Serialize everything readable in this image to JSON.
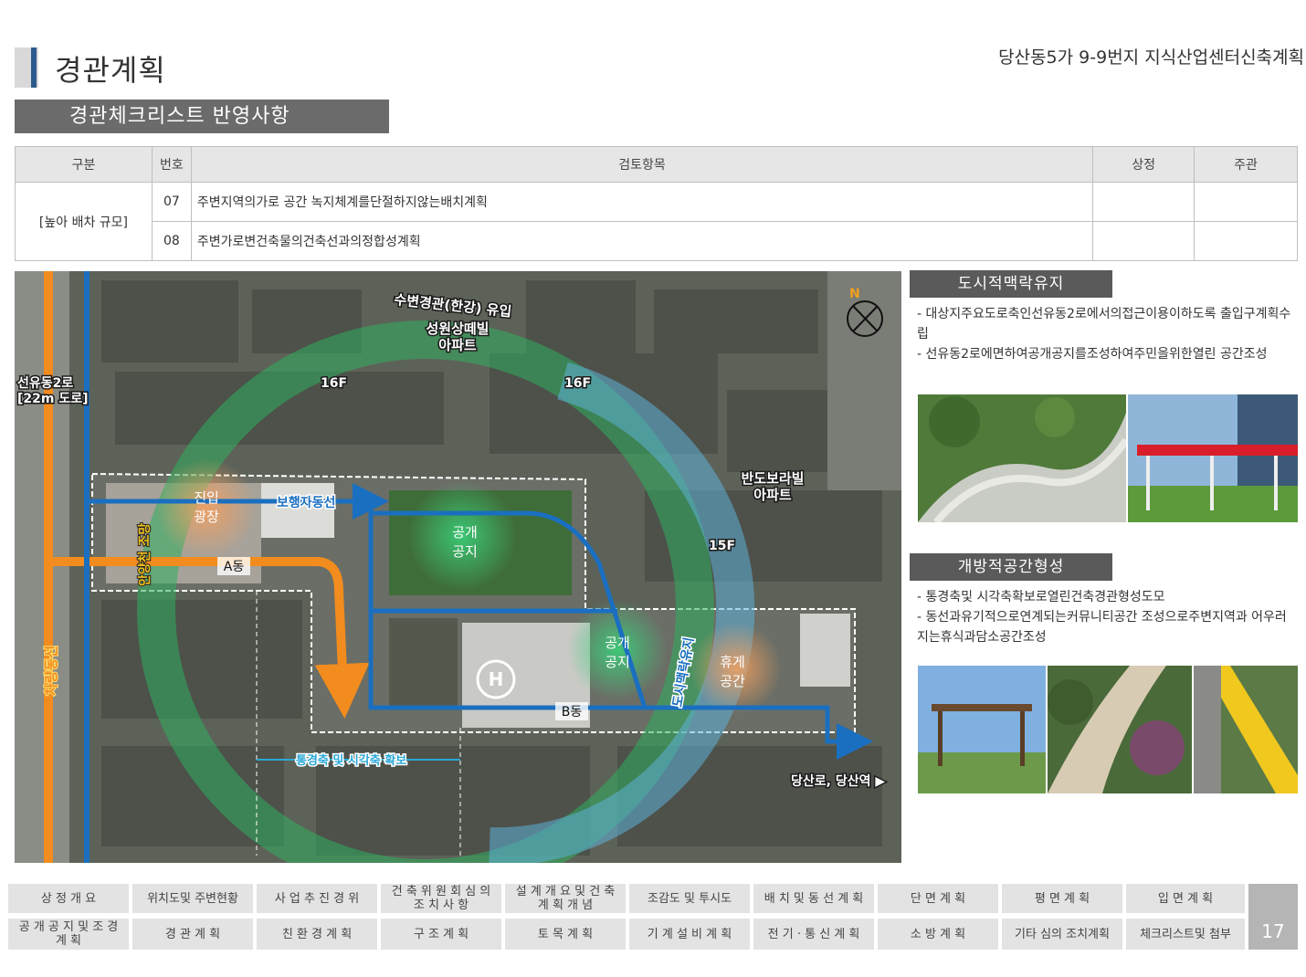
{
  "header": {
    "page_title": "경관계획",
    "doc_title": "당산동5가 9-9번지 지식산업센터신축계획",
    "section_banner": "경관체크리스트 반영사항"
  },
  "table": {
    "headers": [
      "구분",
      "번호",
      "검토항목",
      "상정",
      "주관"
    ],
    "category": "[높아 배차 규모]",
    "rows": [
      {
        "no": "07",
        "item": "주변지역의가로 공간 녹지체계를단절하지않는배치계획",
        "상정": "",
        "주관": ""
      },
      {
        "no": "08",
        "item": "주변가로변건축물의건축선과의정합성계획",
        "상정": "",
        "주관": ""
      }
    ]
  },
  "map": {
    "labels": {
      "waterfront": "수변경관(한강) 유입",
      "apt1_line1": "성원상떼빌",
      "apt1_line2": "아파트",
      "road_west_line1": "선유동2로",
      "road_west_line2": "[22m 도로]",
      "floor_16a": "16F",
      "floor_16b": "16F",
      "apt2_line1": "반도보라빌",
      "apt2_line2": "아파트",
      "floor_15": "15F",
      "entrance_line1": "진입",
      "entrance_line2": "광장",
      "pedestrian": "보행자동선",
      "anyang_view": "안양천 조망",
      "building_a": "A동",
      "public_space1_line1": "공개",
      "public_space1_line2": "공지",
      "public_space2_line1": "공개",
      "public_space2_line2": "공지",
      "rest_line1": "휴게",
      "rest_line2": "공간",
      "urban_context": "도시맥락유지",
      "vehicle": "차량동선",
      "building_b": "B동",
      "axis": "통경축 및 시각축 확보",
      "station": "당산로, 당산역 ▶",
      "north": "N"
    }
  },
  "panels": {
    "context": {
      "title": "도시적맥락유지",
      "bullets": [
        "- 대상지주요도로축인선유동2로에서의접근이용이하도록 출입구계획수립",
        "- 선유동2로에면하여공개공지를조성하여주민을위한열린 공간조성"
      ]
    },
    "open": {
      "title": "개방적공간형성",
      "bullets": [
        "- 통경축및 시각축확보로열린건축경관형성도모",
        "- 동선과유기적으로연계되는커뮤니티공간 조성으로주변지역과 어우러지는휴식과담소공간조성"
      ]
    }
  },
  "nav": {
    "row1": [
      "상 정 개 요",
      "위치도및 주변현황",
      "사 업 추 진 경 위",
      "건 축 위 원 회 심 의 조 치 사 항",
      "설 계 개 요 및 건 축 계 획 개 념",
      "조감도 및 투시도",
      "배 치 및 동 선 계 획",
      "단 면 계 획",
      "평 면 계 획",
      "입 면 계 획"
    ],
    "row2": [
      "공 개 공 지 및 조 경 계 획",
      "경 관 계 획",
      "친 환 경 계 획",
      "구 조 계 획",
      "토 목 계 획",
      "기 계 설 비 계 획",
      "전 기 · 통 신 계 획",
      "소 방 계 획",
      "기타 심의 조치계획",
      "체크리스트및 첨부"
    ],
    "page_number": "17"
  },
  "colors": {
    "accent_blue": "#2d5a8c",
    "orange_route": "#f28c1e",
    "blue_route": "#1a6fc0",
    "green_ring": "#2fae5e",
    "blue_ring": "#5fb0d8"
  }
}
